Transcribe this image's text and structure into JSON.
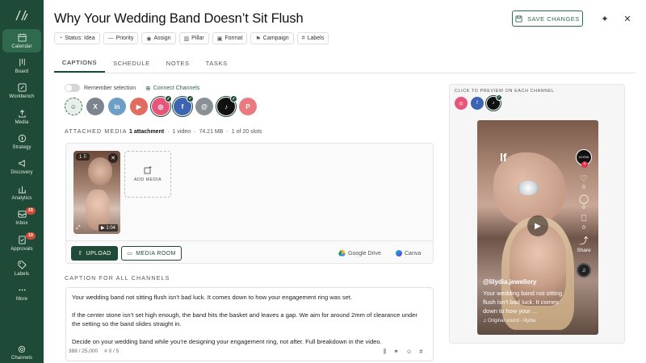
{
  "sidebar": {
    "logo": "\\\\",
    "items": [
      {
        "label": "Calendar",
        "icon": "calendar-icon",
        "active": true
      },
      {
        "label": "Board",
        "icon": "board-icon"
      },
      {
        "label": "Workbench",
        "icon": "edit-icon"
      },
      {
        "label": "Media",
        "icon": "upload-icon"
      },
      {
        "label": "Strategy",
        "icon": "compass-icon"
      },
      {
        "label": "Discovery",
        "icon": "megaphone-icon"
      },
      {
        "label": "Analytics",
        "icon": "chart-icon"
      },
      {
        "label": "Inbox",
        "icon": "inbox-icon",
        "badge": "15"
      },
      {
        "label": "Approvals",
        "icon": "approvals-icon",
        "badge": "10"
      },
      {
        "label": "Labels",
        "icon": "tag-icon"
      },
      {
        "label": "More",
        "icon": "more-icon"
      }
    ],
    "bottom": {
      "label": "Channels",
      "icon": "at-icon"
    }
  },
  "header": {
    "title": "Why Your Wedding Band Doesn’t Sit Flush",
    "save_label": "SAVE CHANGES"
  },
  "chips": [
    {
      "label": "Status: Idea",
      "icon": "status-icon"
    },
    {
      "label": "Priority",
      "icon": "priority-icon"
    },
    {
      "label": "Assign",
      "icon": "user-icon"
    },
    {
      "label": "Pillar",
      "icon": "pillar-icon"
    },
    {
      "label": "Format",
      "icon": "format-icon"
    },
    {
      "label": "Campaign",
      "icon": "flag-icon"
    },
    {
      "label": "Labels",
      "icon": "hash-icon"
    }
  ],
  "tabs": [
    "CAPTIONS",
    "SCHEDULE",
    "NOTES",
    "TASKS"
  ],
  "remember_label": "Remember selection",
  "connect_label": "Connect Channels",
  "channels": [
    {
      "name": "group",
      "icon": "group-icon",
      "color": "#e9efe9",
      "glyph": "☺",
      "selected": false,
      "dashed": true
    },
    {
      "name": "x",
      "icon": "x-icon",
      "color": "#7c858f",
      "glyph": "X",
      "selected": false
    },
    {
      "name": "linkedin",
      "icon": "linkedin-icon",
      "color": "#6d9ec6",
      "glyph": "in",
      "selected": false
    },
    {
      "name": "youtube",
      "icon": "youtube-icon",
      "color": "#e36c61",
      "glyph": "▶",
      "selected": false
    },
    {
      "name": "instagram",
      "icon": "instagram-icon",
      "color": "#e8557a",
      "glyph": "◎",
      "selected": true
    },
    {
      "name": "facebook",
      "icon": "facebook-icon",
      "color": "#3d63b3",
      "glyph": "f",
      "selected": true
    },
    {
      "name": "threads",
      "icon": "threads-icon",
      "color": "#8b9096",
      "glyph": "@",
      "selected": false
    },
    {
      "name": "tiktok",
      "icon": "tiktok-icon",
      "color": "#111111",
      "glyph": "♪",
      "selected": true
    },
    {
      "name": "pinterest",
      "icon": "pinterest-icon",
      "color": "#e97a7f",
      "glyph": "P",
      "selected": false
    }
  ],
  "media": {
    "section_label": "ATTACHED MEDIA",
    "attachments": "1 attachment",
    "videos": "1 video",
    "size": "74.21 MB",
    "slots": "1 of 20 slots",
    "thumb_index": "1",
    "duration": "1:04",
    "add_label": "ADD MEDIA",
    "upload_label": "UPLOAD",
    "mediaroom_label": "MEDIA ROOM",
    "gdrive_label": "Google Drive",
    "canva_label": "Canva"
  },
  "caption": {
    "section_label": "CAPTION FOR ALL CHANNELS",
    "paragraphs": [
      "Your wedding band not sitting flush isn’t bad luck. It comes down to how your engagement ring was set.",
      "If the center stone isn’t set high enough, the band hits the basket and leaves a gap. We aim for around 2mm of clearance under the setting so the band slides straight in.",
      "Decide on your wedding band while you’re designing your engagement ring, not after. Full breakdown in the video."
    ],
    "char_count": "388 / 25,000",
    "hashtag_count": "# 0 / 5"
  },
  "preview": {
    "label": "CLICK TO PREVIEW ON EACH CHANNEL",
    "channels": [
      {
        "icon": "instagram-icon",
        "color": "#e8557a",
        "glyph": "◎",
        "active": false
      },
      {
        "icon": "facebook-icon",
        "color": "#3d63b3",
        "glyph": "f",
        "active": false
      },
      {
        "icon": "tiktok-icon",
        "color": "#111111",
        "glyph": "♪",
        "active": true
      }
    ],
    "overlay_text": "lf",
    "likes": "0",
    "comments": "0",
    "saves": "0",
    "share_label": "Share",
    "username": "@lilydia.jewellery",
    "caption": "Your wedding band not sitting flush isn’t bad luck. It comes down to how your ...",
    "sound": "♫ Original sound - lilydia"
  }
}
